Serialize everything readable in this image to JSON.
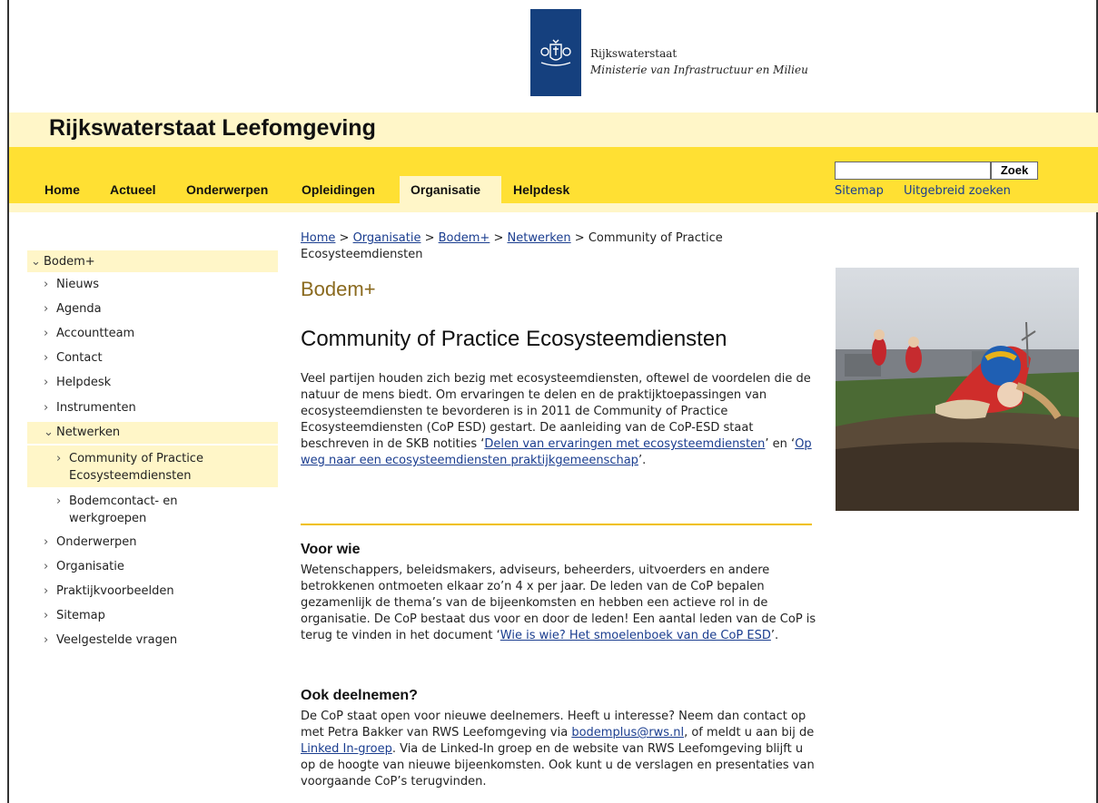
{
  "header": {
    "org_name": "Rijkswaterstaat",
    "ministry": "Ministerie van Infrastructuur en Milieu",
    "site_title": "Rijkswaterstaat Leefomgeving"
  },
  "nav": {
    "items": [
      "Home",
      "Actueel",
      "Onderwerpen",
      "Opleidingen",
      "Organisatie",
      "Helpdesk"
    ],
    "active": "Organisatie"
  },
  "search": {
    "value": "",
    "button_label": "Zoek",
    "sitemap_label": "Sitemap",
    "advanced_label": "Uitgebreid zoeken"
  },
  "sidebar": {
    "items": [
      {
        "label": "Bodem+",
        "expanded": true
      },
      {
        "label": "Nieuws"
      },
      {
        "label": "Agenda"
      },
      {
        "label": "Accountteam"
      },
      {
        "label": "Contact"
      },
      {
        "label": "Helpdesk"
      },
      {
        "label": "Instrumenten"
      },
      {
        "label": "Netwerken",
        "expanded": true
      },
      {
        "label": "Community of Practice Ecosysteemdiensten",
        "line1": "Community of Practice",
        "line2": "Ecosysteemdiensten",
        "current": true
      },
      {
        "label": "Bodemcontact- en werkgroepen",
        "line1": "Bodemcontact- en",
        "line2": "werkgroepen"
      },
      {
        "label": "Onderwerpen"
      },
      {
        "label": "Organisatie"
      },
      {
        "label": "Praktijkvoorbeelden"
      },
      {
        "label": "Sitemap"
      },
      {
        "label": "Veelgestelde vragen"
      }
    ]
  },
  "breadcrumb": {
    "links": [
      "Home",
      "Organisatie",
      "Bodem+",
      "Netwerken"
    ],
    "separator": ">",
    "current": "Community of Practice Ecosysteemdiensten"
  },
  "main": {
    "section_title": "Bodem+",
    "page_title": "Community of Practice Ecosysteemdiensten",
    "intro": {
      "text": "Veel partijen houden zich bezig met ecosysteemdiensten, oftewel de voordelen die de natuur de mens biedt. Om ervaringen te delen en de praktijktoepassingen van ecosysteemdiensten te bevorderen is in 2011 de Community of Practice Ecosysteemdiensten (CoP ESD) gestart. De aanleiding van de CoP-ESD staat beschreven in de SKB notities ‘",
      "link1": "Delen van ervaringen met ecosysteemdiensten",
      "mid": "’ en ‘",
      "link2": "Op weg naar een ecosysteemdiensten praktijkgemeenschap",
      "end": "’."
    },
    "voor_wie": {
      "heading": "Voor wie",
      "text": "Wetenschappers, beleidsmakers, adviseurs, beheerders, uitvoerders en andere betrokkenen ontmoeten elkaar zo’n 4 x per jaar. De leden van de CoP bepalen gezamenlijk de thema’s van de bijeenkomsten en hebben een actieve rol in de organisatie. De CoP bestaat dus voor en door de leden! Een aantal leden van de CoP is terug te vinden in het document ‘",
      "link": "Wie is wie? Het smoelenboek van de CoP ESD",
      "end": "’."
    },
    "deelnemen": {
      "heading": "Ook deelnemen?",
      "text1": "De CoP staat open voor nieuwe deelnemers. Heeft u interesse? Neem dan contact op met Petra Bakker van RWS Leefomgeving via ",
      "email": "bodemplus@rws.nl",
      "text2": ", of meldt u aan bij de ",
      "link": "Linked In-groep",
      "text3": ". Via de Linked-In groep en de website van RWS Leefomgeving blijft u op de hoogte van nieuwe bijeenkomsten. Ook kunt u de verslagen en presentaties van voorgaande CoP’s terugvinden."
    }
  },
  "colors": {
    "nav_yellow": "#ffe033",
    "band_pale": "#fff6c8",
    "brand_blue": "#15407e",
    "section_gold": "#8a6a1f",
    "divider": "#f0c000"
  }
}
